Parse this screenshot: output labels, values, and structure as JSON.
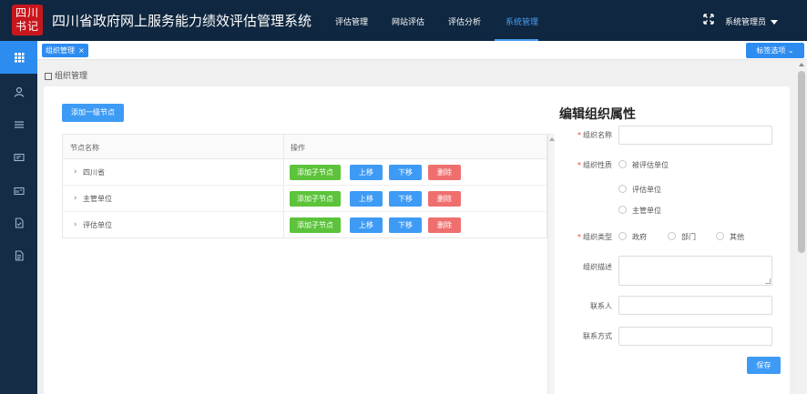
{
  "header": {
    "logo_text": "四川书记",
    "title": "四川省政府网上服务能力绩效评估管理系统",
    "nav": [
      "评估管理",
      "网站评估",
      "评估分析",
      "系统管理"
    ],
    "active_nav": "系统管理",
    "user": "系统管理员",
    "colors": {
      "bar": "#0f2740",
      "active": "#4a9ff5"
    }
  },
  "sidebar": {
    "items": [
      {
        "icon": "grid-icon",
        "active": true
      },
      {
        "icon": "user-icon",
        "active": false
      },
      {
        "icon": "list-icon",
        "active": false
      },
      {
        "icon": "card-icon",
        "active": false
      },
      {
        "icon": "id-card-icon",
        "active": false
      },
      {
        "icon": "document-icon",
        "active": false
      },
      {
        "icon": "report-icon",
        "active": false
      }
    ]
  },
  "tabs": {
    "open_tab": "组织管理",
    "close_glyph": "×",
    "tag_options": "标签选项"
  },
  "breadcrumb": "组织管理",
  "tree": {
    "add_top_label": "添加一级节点",
    "columns": [
      "节点名称",
      "操作"
    ],
    "rows": [
      {
        "name": "四川省"
      },
      {
        "name": "主管单位"
      },
      {
        "name": "评估单位"
      }
    ],
    "actions": {
      "add_child": "添加子节点",
      "up": "上移",
      "down": "下移",
      "delete": "删除"
    }
  },
  "form": {
    "title": "编辑组织属性",
    "name_label": "组织名称",
    "nature_label": "组织性质",
    "nature_options": [
      "被评估单位",
      "评估单位",
      "主管单位"
    ],
    "type_label": "组织类型",
    "type_options": [
      "政府",
      "部门",
      "其他"
    ],
    "desc_label": "组织描述",
    "contact_label": "联系人",
    "contact_method_label": "联系方式",
    "save_label": "保存",
    "required_mark": "*"
  }
}
